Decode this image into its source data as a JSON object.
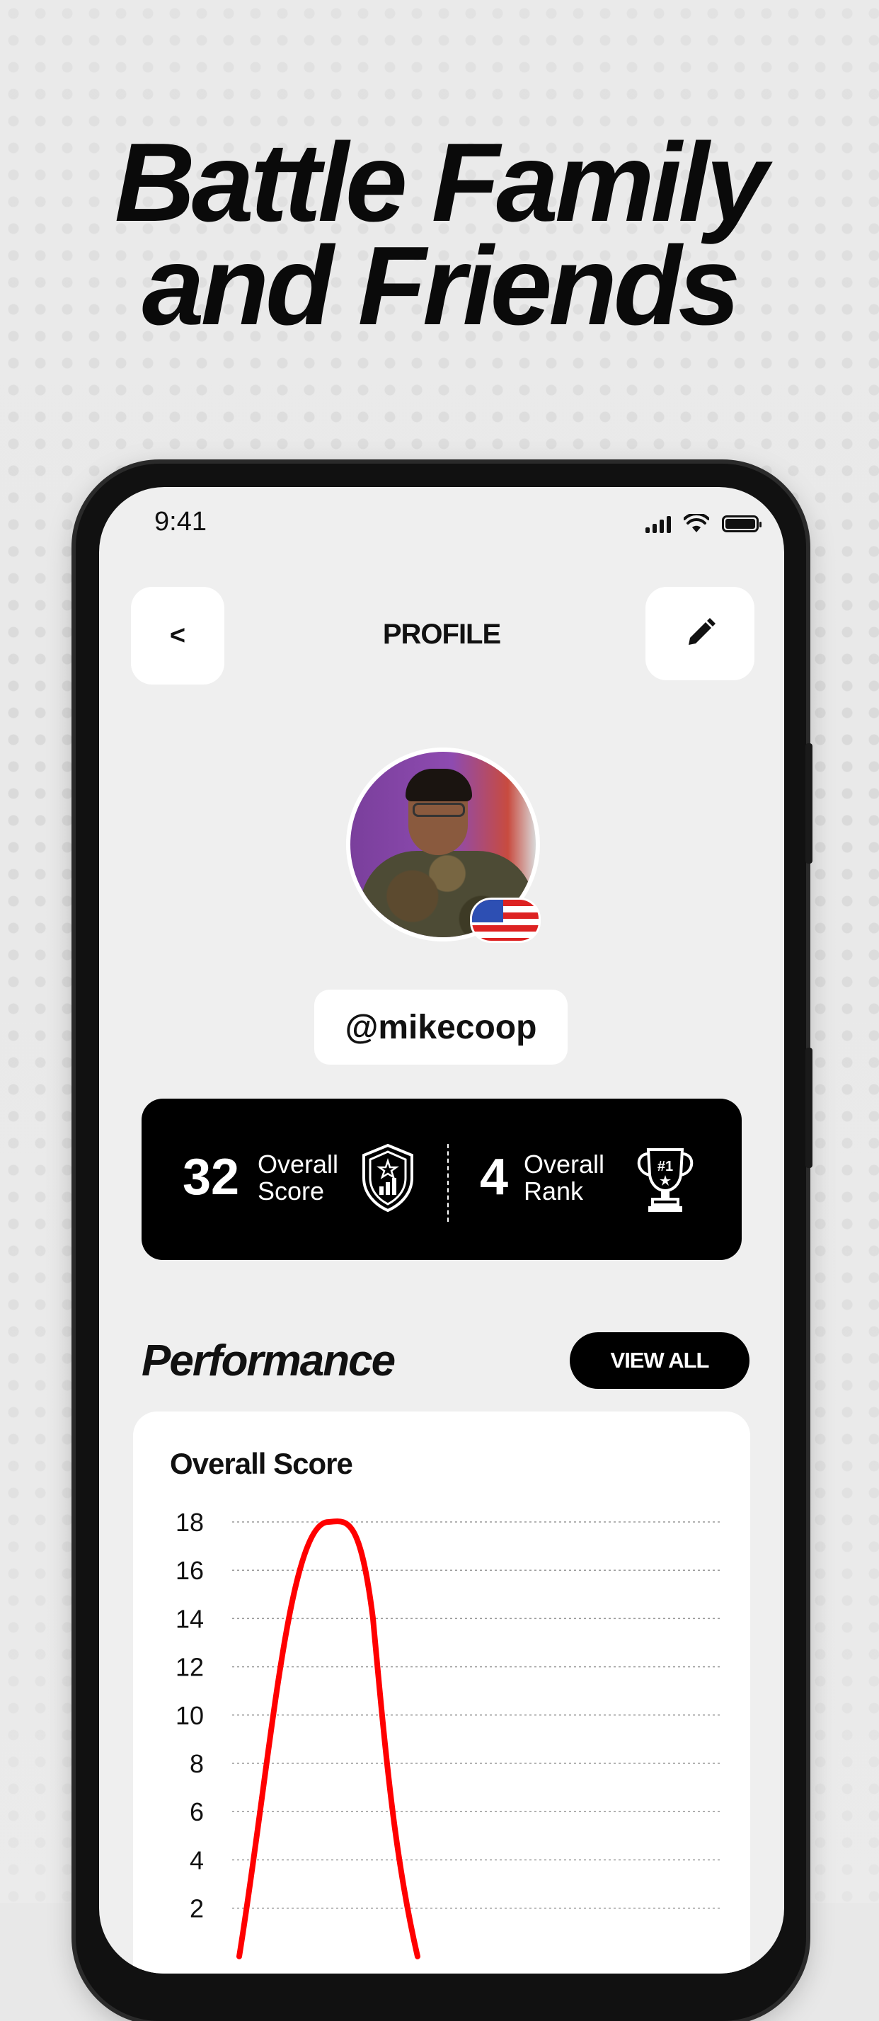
{
  "headline": {
    "line1": "Battle Family",
    "line2": "and Friends"
  },
  "status_bar": {
    "time": "9:41"
  },
  "header": {
    "back_label": "<",
    "title": "PROFILE"
  },
  "profile": {
    "username": "@mikecoop",
    "country_flag": "us-flag-icon"
  },
  "stats": {
    "score": {
      "value": "32",
      "label_line1": "Overall",
      "label_line2": "Score"
    },
    "rank": {
      "value": "4",
      "label_line1": "Overall",
      "label_line2": "Rank"
    },
    "rank_badge": "#1"
  },
  "performance": {
    "title": "Performance",
    "view_all_label": "VIEW ALL"
  },
  "chart_data": {
    "type": "line",
    "title": "Overall Score",
    "y_ticks": [
      "18",
      "16",
      "14",
      "12",
      "10",
      "8",
      "6",
      "4",
      "2"
    ],
    "ylim": [
      2,
      18
    ],
    "grid": true,
    "series": [
      {
        "color": "#ff0000",
        "points": [
          [
            0,
            0
          ],
          [
            0.5,
            14
          ],
          [
            1,
            18
          ],
          [
            1.5,
            17.5
          ],
          [
            2,
            0
          ]
        ]
      }
    ]
  },
  "colors": {
    "accent": "#ff0000",
    "dark": "#000000",
    "background": "#efefef"
  }
}
